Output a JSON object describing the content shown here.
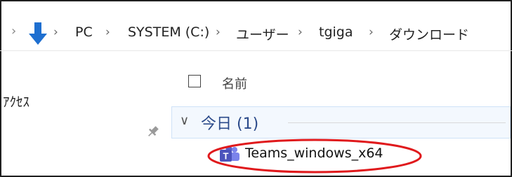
{
  "breadcrumb": {
    "items": [
      "PC",
      "SYSTEM (C:)",
      "ユーザー",
      "tgiga",
      "ダウンロード"
    ],
    "separator": "›"
  },
  "nav": {
    "quick_access": "ｱｸｾｽ"
  },
  "file_list": {
    "column_name": "名前",
    "group_label": "今日 (1)",
    "files": [
      {
        "name": "Teams_windows_x64",
        "icon": "teams-icon"
      }
    ]
  },
  "colors": {
    "highlight_oval": "#e0191c",
    "download_arrow": "#1e6fd0",
    "teams_purple": "#5b5fc7",
    "group_text": "#2b4a8a"
  }
}
